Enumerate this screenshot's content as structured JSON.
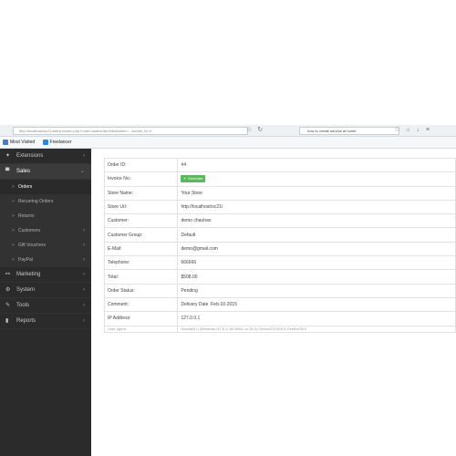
{
  "browser": {
    "url": "http://localhost/oc21/admin/index.php?route=sale/order/info&token=...&order_id=4",
    "search_text": "how to create service at home"
  },
  "bookmarks": [
    {
      "label": "Most Visited",
      "color": "#4a7bd0"
    },
    {
      "label": "Freelancer",
      "color": "#2a8ad8"
    }
  ],
  "sidebar": {
    "items": [
      {
        "label": "Extensions",
        "icon": "puzzle-icon",
        "glyph": "✦",
        "chevron": "›",
        "active": false
      },
      {
        "label": "Sales",
        "icon": "cart-icon",
        "glyph": "🛒",
        "chevron": "⌄",
        "active": true
      }
    ],
    "sales_children": [
      {
        "label": "Orders",
        "current": true,
        "chevron": ""
      },
      {
        "label": "Recurring Orders",
        "current": false,
        "chevron": ""
      },
      {
        "label": "Returns",
        "current": false,
        "chevron": ""
      },
      {
        "label": "Customers",
        "current": false,
        "chevron": "›"
      },
      {
        "label": "Gift Vouchers",
        "current": false,
        "chevron": "›"
      },
      {
        "label": "PayPal",
        "current": false,
        "chevron": "›"
      }
    ],
    "bottom_items": [
      {
        "label": "Marketing",
        "icon": "share-icon",
        "glyph": "⚯",
        "chevron": "›"
      },
      {
        "label": "System",
        "icon": "gear-icon",
        "glyph": "⚙",
        "chevron": "›"
      },
      {
        "label": "Tools",
        "icon": "wrench-icon",
        "glyph": "🔧",
        "chevron": "›"
      },
      {
        "label": "Reports",
        "icon": "chart-icon",
        "glyph": "▮",
        "chevron": "›"
      }
    ]
  },
  "order_details": {
    "rows": [
      {
        "label": "Order ID:",
        "value": "#4",
        "type": "text"
      },
      {
        "label": "Invoice No.:",
        "value": "",
        "type": "button",
        "button_label": "Generate"
      },
      {
        "label": "Store Name:",
        "value": "Your Store",
        "type": "text"
      },
      {
        "label": "Store Url:",
        "value": "http://localhost/oc21/",
        "type": "link"
      },
      {
        "label": "Customer:",
        "value": "demo chauhan",
        "type": "link"
      },
      {
        "label": "Customer Group:",
        "value": "Default",
        "type": "text"
      },
      {
        "label": "E-Mail:",
        "value": "demo@gmail.com",
        "type": "link"
      },
      {
        "label": "Telephone:",
        "value": "666666",
        "type": "text"
      },
      {
        "label": "Total:",
        "value": "$508.00",
        "type": "text"
      },
      {
        "label": "Order Status:",
        "value": "Pending",
        "type": "text"
      },
      {
        "label": "Comment:",
        "value": "Delivery Date :Feb-10-2015",
        "type": "text"
      },
      {
        "label": "IP Address:",
        "value": "127.0.0.1",
        "type": "text"
      },
      {
        "label": "User Agent:",
        "value": "Mozilla/5.0 (Windows NT 6.1; WOW64; rv:35.0) Gecko/20100101 Firefox/35.0",
        "type": "text"
      }
    ]
  }
}
